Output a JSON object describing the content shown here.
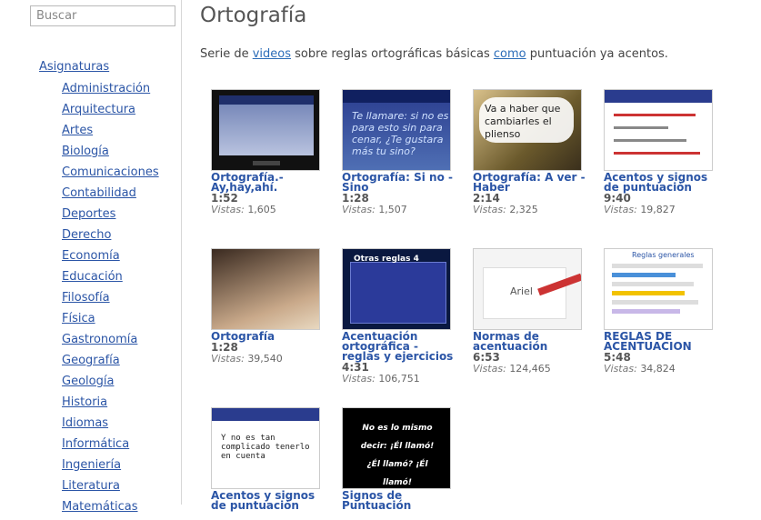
{
  "sidebar": {
    "search_placeholder": "Buscar",
    "heading": "Asignaturas",
    "items": [
      "Administración",
      "Arquitectura",
      "Artes",
      "Biología",
      "Comunicaciones",
      "Contabilidad",
      "Deportes",
      "Derecho",
      "Economía",
      "Educación",
      "Filosofía",
      "Física",
      "Gastronomía",
      "Geografía",
      "Geología",
      "Historia",
      "Idiomas",
      "Informática",
      "Ingeniería",
      "Literatura",
      "Matemáticas"
    ]
  },
  "main": {
    "title": "Ortografía",
    "intro": {
      "part1": "Serie de ",
      "link1": "videos",
      "part2": " sobre reglas ortográficas básicas ",
      "link2": "como",
      "part3": " puntuación ya acentos."
    },
    "views_label": "Vistas:",
    "videos": [
      {
        "title": "Ortografía.- Ay,hay,ahí.",
        "duration": "1:52",
        "views": "1,605",
        "thumb_text": ""
      },
      {
        "title": "Ortografía: Si no - Sino",
        "duration": "1:28",
        "views": "1,507",
        "thumb_text": "Te llamare: si no es para esto sin para cenar, ¿Te gustara más tu sino?"
      },
      {
        "title": "Ortografía: A ver - Haber",
        "duration": "2:14",
        "views": "2,325",
        "thumb_text": "Va a haber que cambiarles el plienso"
      },
      {
        "title": "Acentos y signos de puntuación",
        "duration": "9:40",
        "views": "19,827",
        "thumb_text": ""
      },
      {
        "title": "Ortografía",
        "duration": "1:28",
        "views": "39,540",
        "thumb_text": ""
      },
      {
        "title": "Acentuación ortográfica - reglas y ejercicios",
        "duration": "4:31",
        "views": "106,751",
        "thumb_text": "Otras reglas 4"
      },
      {
        "title": "Normas de acentuación",
        "duration": "6:53",
        "views": "124,465",
        "thumb_text": "Ariel"
      },
      {
        "title": "REGLAS DE ACENTUACION",
        "duration": "5:48",
        "views": "34,824",
        "thumb_text": "Reglas generales"
      },
      {
        "title": "Acentos y signos de puntuación",
        "duration": "",
        "views": "",
        "thumb_text": "Y no es tan complicado tenerlo en cuenta"
      },
      {
        "title": "Signos de Puntuación",
        "duration": "",
        "views": "",
        "thumb_text": "No es lo mismo decir: ¡Él llamó! ¿Él llamó? ¡Él llamó!"
      }
    ]
  }
}
